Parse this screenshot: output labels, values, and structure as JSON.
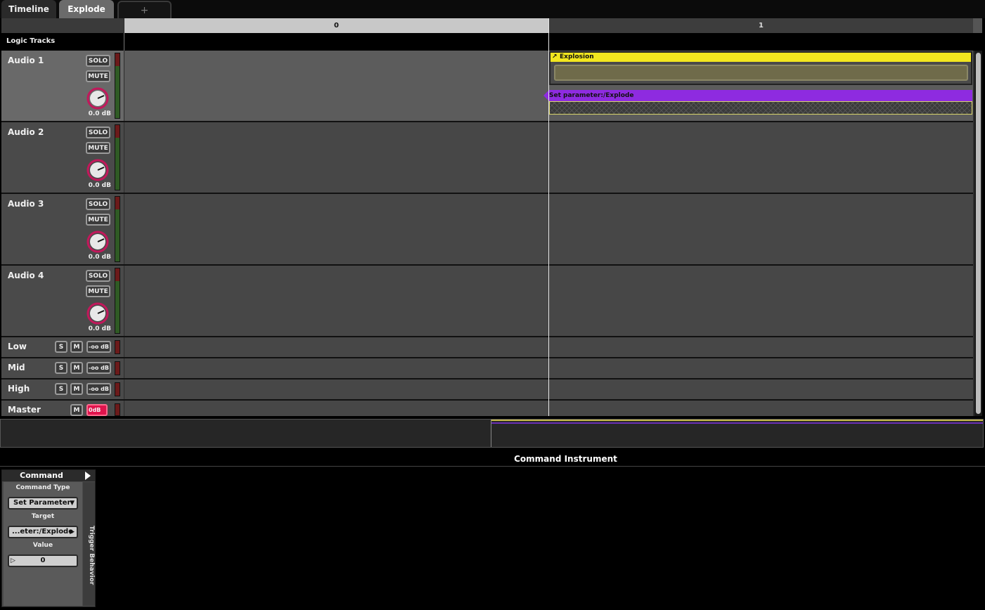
{
  "tabs": [
    {
      "label": "Timeline"
    },
    {
      "label": "Explode"
    },
    {
      "label": "+"
    }
  ],
  "ruler": {
    "markers": [
      "0",
      "1"
    ]
  },
  "logic_tracks_label": "Logic Tracks",
  "audio_tracks": [
    {
      "name": "Audio 1",
      "solo": "SOLO",
      "mute": "MUTE",
      "gain": "0.0 dB"
    },
    {
      "name": "Audio 2",
      "solo": "SOLO",
      "mute": "MUTE",
      "gain": "0.0 dB"
    },
    {
      "name": "Audio 3",
      "solo": "SOLO",
      "mute": "MUTE",
      "gain": "0.0 dB"
    },
    {
      "name": "Audio 4",
      "solo": "SOLO",
      "mute": "MUTE",
      "gain": "0.0 dB"
    }
  ],
  "bus_tracks": [
    {
      "name": "Low",
      "solo": "S",
      "mute": "M",
      "gain": "-oo dB"
    },
    {
      "name": "Mid",
      "solo": "S",
      "mute": "M",
      "gain": "-oo dB"
    },
    {
      "name": "High",
      "solo": "S",
      "mute": "M",
      "gain": "-oo dB"
    }
  ],
  "master": {
    "name": "Master",
    "mute": "M",
    "gain": "0dB"
  },
  "instruments": {
    "explosion": "Explosion",
    "set_parameter": "Set parameter:/Explode"
  },
  "deck_title": "Command Instrument",
  "command": {
    "title": "Command",
    "type_label": "Command Type",
    "type_value": "Set Parameter",
    "target_label": "Target",
    "target_value": "...eter:/Explode",
    "value_label": "Value",
    "value": "0",
    "side_label": "Trigger Behavior"
  },
  "colors": {
    "explosion": "#f2e61f",
    "set_parameter": "#8e2be0",
    "knob_ring": "#c2185b"
  }
}
